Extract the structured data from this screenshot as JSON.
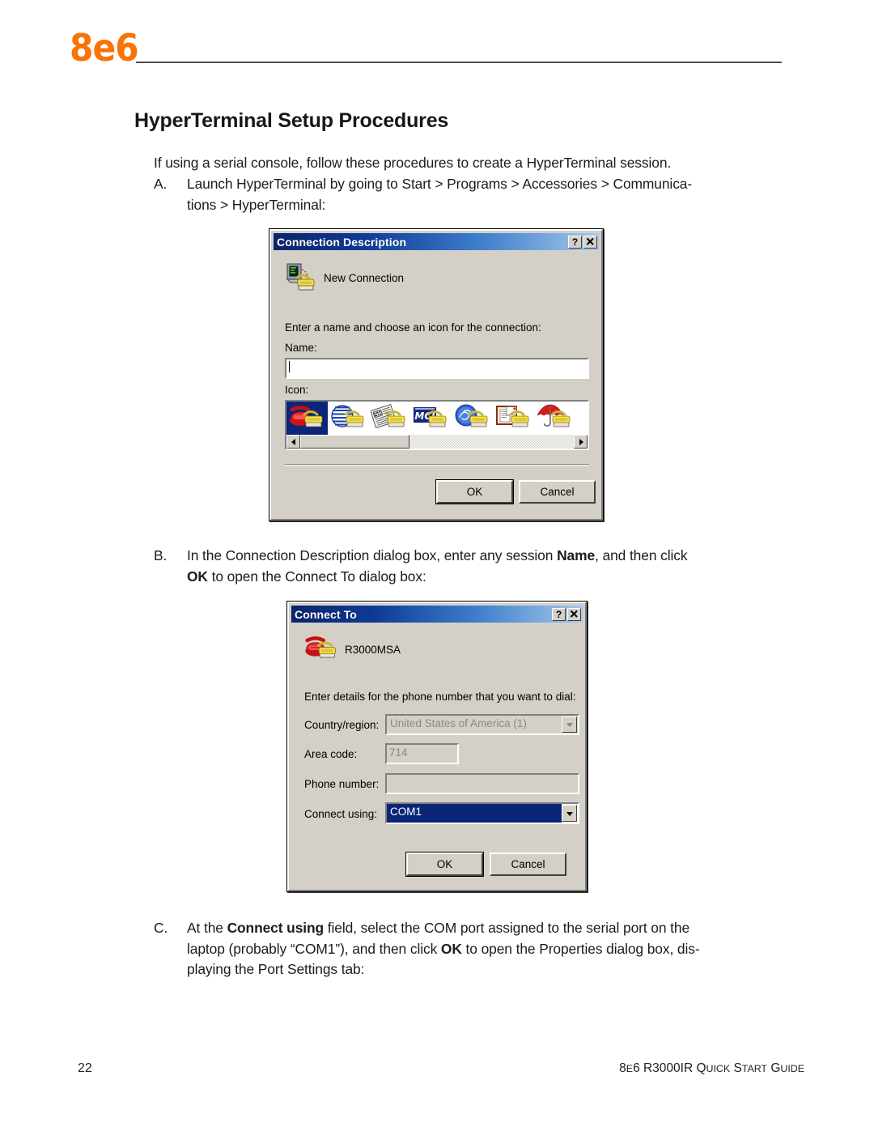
{
  "page": {
    "brand_logo": "8e6",
    "title": "HyperTerminal Setup Procedures",
    "intro": "If using a serial console, follow these procedures to create a HyperTerminal session.",
    "brand_color": "#F97306"
  },
  "steps": [
    {
      "marker": "A.",
      "text_parts": [
        {
          "t": "Launch HyperTerminal by going to Start > Programs > Accessories > Communica-tions > HyperTerminal:",
          "bold": false
        }
      ],
      "plain": "Launch HyperTerminal by going to Start > Programs > Accessories > Communications > HyperTerminal:"
    },
    {
      "marker": "B.",
      "plain": "In the Connection Description dialog box, enter any session Name, and then click OK to open the Connect To dialog box:"
    },
    {
      "marker": "C.",
      "plain": "At the Connect using field, select the COM port assigned to the serial port on the laptop (probably “COM1”), and then click OK to open the Properties dialog box, displaying the Port Settings tab:"
    }
  ],
  "dialog_connection_description": {
    "title": "Connection Description",
    "help_button": "?",
    "close_button": "✕",
    "app_name": "New Connection",
    "app_icon": "computer-phone-icon",
    "instruction": "Enter a name and choose an icon for the connection:",
    "name_label": "Name:",
    "name_value": "",
    "icon_label": "Icon:",
    "icons": [
      {
        "name": "red-telephone-icon",
        "selected": true
      },
      {
        "name": "blue-globe-icon",
        "selected": false
      },
      {
        "name": "newspaper-icon",
        "selected": false
      },
      {
        "name": "mci-logo-icon",
        "selected": false,
        "label": "MCI"
      },
      {
        "name": "blue-swirl-icon",
        "selected": false
      },
      {
        "name": "documents-icon",
        "selected": false
      },
      {
        "name": "red-umbrella-icon",
        "selected": false
      }
    ],
    "ok_label": "OK",
    "cancel_label": "Cancel"
  },
  "dialog_connect_to": {
    "title": "Connect To",
    "help_button": "?",
    "close_button": "✕",
    "session_name": "R3000MSA",
    "session_icon": "red-telephone-icon",
    "instruction": "Enter details for the phone number that you want to dial:",
    "fields": [
      {
        "label": "Country/region:",
        "value": "United States of America (1)",
        "type": "combo",
        "disabled": true
      },
      {
        "label": "Area code:",
        "value": "714",
        "type": "text",
        "disabled": true
      },
      {
        "label": "Phone number:",
        "value": "",
        "type": "text",
        "disabled": true
      },
      {
        "label": "Connect using:",
        "value": "COM1",
        "type": "combo",
        "disabled": false,
        "selected": true
      }
    ],
    "ok_label": "OK",
    "cancel_label": "Cancel",
    "highlight_color": "#0b2678"
  },
  "footer": {
    "page_number": "22",
    "doc_title_plain": "8E6 R3000IR QUICK START GUIDE"
  }
}
